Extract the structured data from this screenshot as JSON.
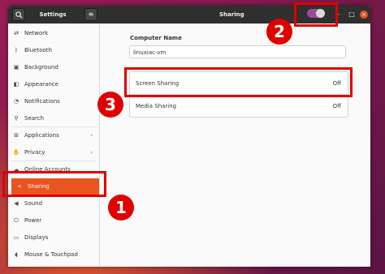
{
  "header": {
    "left_title": "Settings",
    "panel_title": "Sharing",
    "menu_icon": "≡",
    "minimize": "–",
    "maximize": "□",
    "close": "×"
  },
  "sharing_toggle": {
    "state": "on",
    "color": "#9b4c9b"
  },
  "sidebar": {
    "items": [
      {
        "label": "Network",
        "icon": "network-icon"
      },
      {
        "label": "Bluetooth",
        "icon": "bluetooth-icon"
      },
      {
        "label": "Background",
        "icon": "background-icon"
      },
      {
        "label": "Appearance",
        "icon": "appearance-icon"
      },
      {
        "label": "Notifications",
        "icon": "bell-icon"
      },
      {
        "label": "Search",
        "icon": "search-icon"
      },
      {
        "label": "Applications",
        "icon": "applications-icon",
        "chevron": "›"
      },
      {
        "label": "Privacy",
        "icon": "privacy-icon",
        "chevron": "›"
      },
      {
        "label": "Online Accounts",
        "icon": "cloud-icon"
      },
      {
        "label": "Sharing",
        "icon": "share-icon",
        "selected": true
      },
      {
        "label": "Sound",
        "icon": "sound-icon"
      },
      {
        "label": "Power",
        "icon": "power-icon"
      },
      {
        "label": "Displays",
        "icon": "display-icon"
      },
      {
        "label": "Mouse & Touchpad",
        "icon": "mouse-icon"
      }
    ]
  },
  "content": {
    "computer_name_label": "Computer Name",
    "computer_name_value": "linuxiac-vm",
    "rows": [
      {
        "name": "Screen Sharing",
        "state": "Off"
      },
      {
        "name": "Media Sharing",
        "state": "Off"
      }
    ]
  },
  "annotations": [
    {
      "number": "1",
      "color": "#e00000"
    },
    {
      "number": "2",
      "color": "#e00000"
    },
    {
      "number": "3",
      "color": "#e00000"
    }
  ],
  "accent_color": "#e95420"
}
